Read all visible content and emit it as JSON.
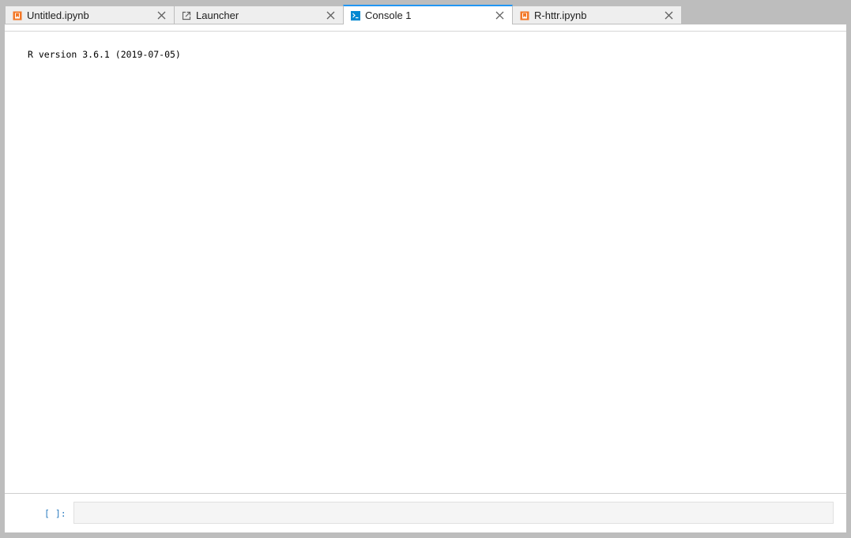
{
  "tabs": [
    {
      "label": "Untitled.ipynb",
      "icon": "notebook-icon",
      "active": false
    },
    {
      "label": "Launcher",
      "icon": "launch-icon",
      "active": false
    },
    {
      "label": "Console 1",
      "icon": "console-icon",
      "active": true
    },
    {
      "label": "R-httr.ipynb",
      "icon": "notebook-icon",
      "active": false
    }
  ],
  "console": {
    "banner": "R version 3.6.1 (2019-07-05)",
    "prompt": "[ ]:",
    "input_value": ""
  },
  "colors": {
    "active_tab_accent": "#2196f3",
    "notebook_icon": "#f37726",
    "console_icon": "#0288d1",
    "prompt": "#307fc1"
  }
}
